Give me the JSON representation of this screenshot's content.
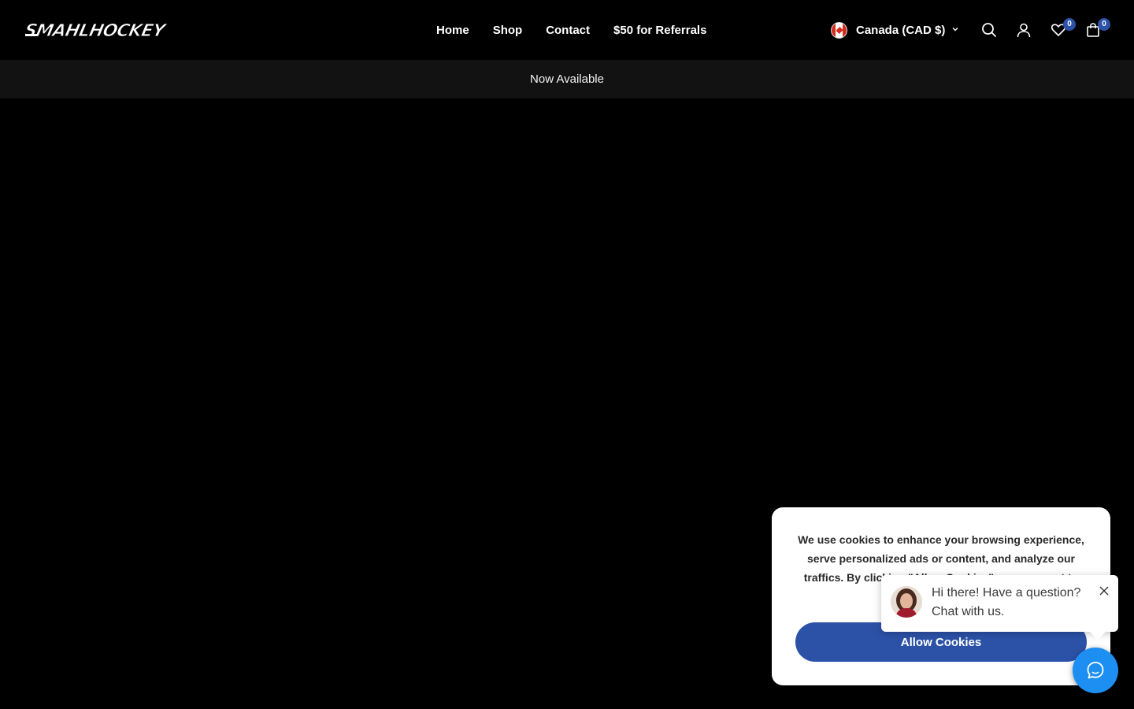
{
  "brand": {
    "logo_text": "SMAHLHOCKEY"
  },
  "nav": {
    "items": [
      {
        "label": "Home"
      },
      {
        "label": "Shop"
      },
      {
        "label": "Contact"
      },
      {
        "label": "$50 for Referrals"
      }
    ]
  },
  "header": {
    "locale_label": "Canada (CAD $)",
    "wishlist_count": "0",
    "cart_count": "0",
    "icons": [
      "search-icon",
      "account-icon",
      "heart-icon",
      "shopping-bag-icon"
    ]
  },
  "announcement": {
    "text": "Now Available"
  },
  "cookie_banner": {
    "text": "We use cookies to enhance your browsing experience, serve personalized ads or content, and analyze our traffics. By clicking \"Allow Cookies\", you consent to",
    "button_label": "Allow Cookies"
  },
  "chat": {
    "message": "Hi there! Have a question? Chat with us."
  },
  "colors": {
    "background": "#000000",
    "announcement_bar": "#121212",
    "accent_blue": "#2c52a8",
    "chat_blue": "#1d8ff2"
  }
}
